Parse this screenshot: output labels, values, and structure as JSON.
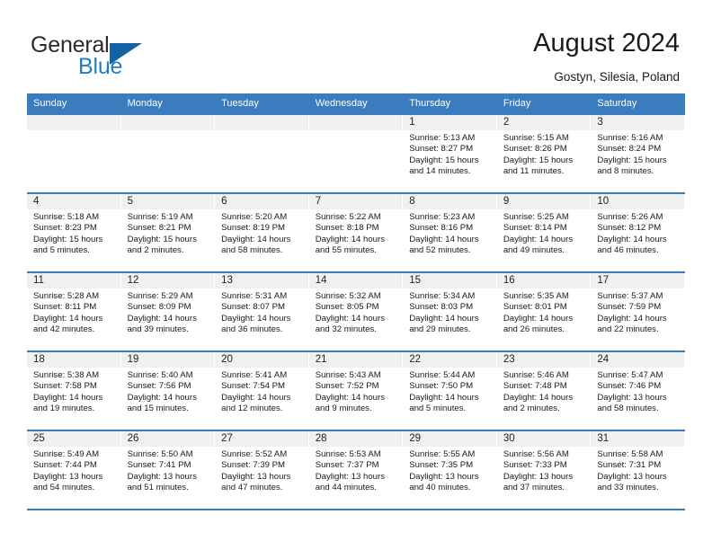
{
  "brand": {
    "name_top": "General",
    "name_bottom": "Blue",
    "triangle_color": "#1464a5",
    "blue_color": "#1f7fc4"
  },
  "header": {
    "title": "August 2024",
    "subtitle": "Gostyn, Silesia, Poland"
  },
  "theme": {
    "header_blue": "#3a7cbe",
    "day_band_gray": "#f0f0f0",
    "text_color": "#1a1a1a"
  },
  "weekdays": [
    "Sunday",
    "Monday",
    "Tuesday",
    "Wednesday",
    "Thursday",
    "Friday",
    "Saturday"
  ],
  "weeks": [
    [
      {
        "day": "",
        "sunrise": "",
        "sunset": "",
        "daylight_line1": "",
        "daylight_line2": ""
      },
      {
        "day": "",
        "sunrise": "",
        "sunset": "",
        "daylight_line1": "",
        "daylight_line2": ""
      },
      {
        "day": "",
        "sunrise": "",
        "sunset": "",
        "daylight_line1": "",
        "daylight_line2": ""
      },
      {
        "day": "",
        "sunrise": "",
        "sunset": "",
        "daylight_line1": "",
        "daylight_line2": ""
      },
      {
        "day": "1",
        "sunrise": "Sunrise: 5:13 AM",
        "sunset": "Sunset: 8:27 PM",
        "daylight_line1": "Daylight: 15 hours",
        "daylight_line2": "and 14 minutes."
      },
      {
        "day": "2",
        "sunrise": "Sunrise: 5:15 AM",
        "sunset": "Sunset: 8:26 PM",
        "daylight_line1": "Daylight: 15 hours",
        "daylight_line2": "and 11 minutes."
      },
      {
        "day": "3",
        "sunrise": "Sunrise: 5:16 AM",
        "sunset": "Sunset: 8:24 PM",
        "daylight_line1": "Daylight: 15 hours",
        "daylight_line2": "and 8 minutes."
      }
    ],
    [
      {
        "day": "4",
        "sunrise": "Sunrise: 5:18 AM",
        "sunset": "Sunset: 8:23 PM",
        "daylight_line1": "Daylight: 15 hours",
        "daylight_line2": "and 5 minutes."
      },
      {
        "day": "5",
        "sunrise": "Sunrise: 5:19 AM",
        "sunset": "Sunset: 8:21 PM",
        "daylight_line1": "Daylight: 15 hours",
        "daylight_line2": "and 2 minutes."
      },
      {
        "day": "6",
        "sunrise": "Sunrise: 5:20 AM",
        "sunset": "Sunset: 8:19 PM",
        "daylight_line1": "Daylight: 14 hours",
        "daylight_line2": "and 58 minutes."
      },
      {
        "day": "7",
        "sunrise": "Sunrise: 5:22 AM",
        "sunset": "Sunset: 8:18 PM",
        "daylight_line1": "Daylight: 14 hours",
        "daylight_line2": "and 55 minutes."
      },
      {
        "day": "8",
        "sunrise": "Sunrise: 5:23 AM",
        "sunset": "Sunset: 8:16 PM",
        "daylight_line1": "Daylight: 14 hours",
        "daylight_line2": "and 52 minutes."
      },
      {
        "day": "9",
        "sunrise": "Sunrise: 5:25 AM",
        "sunset": "Sunset: 8:14 PM",
        "daylight_line1": "Daylight: 14 hours",
        "daylight_line2": "and 49 minutes."
      },
      {
        "day": "10",
        "sunrise": "Sunrise: 5:26 AM",
        "sunset": "Sunset: 8:12 PM",
        "daylight_line1": "Daylight: 14 hours",
        "daylight_line2": "and 46 minutes."
      }
    ],
    [
      {
        "day": "11",
        "sunrise": "Sunrise: 5:28 AM",
        "sunset": "Sunset: 8:11 PM",
        "daylight_line1": "Daylight: 14 hours",
        "daylight_line2": "and 42 minutes."
      },
      {
        "day": "12",
        "sunrise": "Sunrise: 5:29 AM",
        "sunset": "Sunset: 8:09 PM",
        "daylight_line1": "Daylight: 14 hours",
        "daylight_line2": "and 39 minutes."
      },
      {
        "day": "13",
        "sunrise": "Sunrise: 5:31 AM",
        "sunset": "Sunset: 8:07 PM",
        "daylight_line1": "Daylight: 14 hours",
        "daylight_line2": "and 36 minutes."
      },
      {
        "day": "14",
        "sunrise": "Sunrise: 5:32 AM",
        "sunset": "Sunset: 8:05 PM",
        "daylight_line1": "Daylight: 14 hours",
        "daylight_line2": "and 32 minutes."
      },
      {
        "day": "15",
        "sunrise": "Sunrise: 5:34 AM",
        "sunset": "Sunset: 8:03 PM",
        "daylight_line1": "Daylight: 14 hours",
        "daylight_line2": "and 29 minutes."
      },
      {
        "day": "16",
        "sunrise": "Sunrise: 5:35 AM",
        "sunset": "Sunset: 8:01 PM",
        "daylight_line1": "Daylight: 14 hours",
        "daylight_line2": "and 26 minutes."
      },
      {
        "day": "17",
        "sunrise": "Sunrise: 5:37 AM",
        "sunset": "Sunset: 7:59 PM",
        "daylight_line1": "Daylight: 14 hours",
        "daylight_line2": "and 22 minutes."
      }
    ],
    [
      {
        "day": "18",
        "sunrise": "Sunrise: 5:38 AM",
        "sunset": "Sunset: 7:58 PM",
        "daylight_line1": "Daylight: 14 hours",
        "daylight_line2": "and 19 minutes."
      },
      {
        "day": "19",
        "sunrise": "Sunrise: 5:40 AM",
        "sunset": "Sunset: 7:56 PM",
        "daylight_line1": "Daylight: 14 hours",
        "daylight_line2": "and 15 minutes."
      },
      {
        "day": "20",
        "sunrise": "Sunrise: 5:41 AM",
        "sunset": "Sunset: 7:54 PM",
        "daylight_line1": "Daylight: 14 hours",
        "daylight_line2": "and 12 minutes."
      },
      {
        "day": "21",
        "sunrise": "Sunrise: 5:43 AM",
        "sunset": "Sunset: 7:52 PM",
        "daylight_line1": "Daylight: 14 hours",
        "daylight_line2": "and 9 minutes."
      },
      {
        "day": "22",
        "sunrise": "Sunrise: 5:44 AM",
        "sunset": "Sunset: 7:50 PM",
        "daylight_line1": "Daylight: 14 hours",
        "daylight_line2": "and 5 minutes."
      },
      {
        "day": "23",
        "sunrise": "Sunrise: 5:46 AM",
        "sunset": "Sunset: 7:48 PM",
        "daylight_line1": "Daylight: 14 hours",
        "daylight_line2": "and 2 minutes."
      },
      {
        "day": "24",
        "sunrise": "Sunrise: 5:47 AM",
        "sunset": "Sunset: 7:46 PM",
        "daylight_line1": "Daylight: 13 hours",
        "daylight_line2": "and 58 minutes."
      }
    ],
    [
      {
        "day": "25",
        "sunrise": "Sunrise: 5:49 AM",
        "sunset": "Sunset: 7:44 PM",
        "daylight_line1": "Daylight: 13 hours",
        "daylight_line2": "and 54 minutes."
      },
      {
        "day": "26",
        "sunrise": "Sunrise: 5:50 AM",
        "sunset": "Sunset: 7:41 PM",
        "daylight_line1": "Daylight: 13 hours",
        "daylight_line2": "and 51 minutes."
      },
      {
        "day": "27",
        "sunrise": "Sunrise: 5:52 AM",
        "sunset": "Sunset: 7:39 PM",
        "daylight_line1": "Daylight: 13 hours",
        "daylight_line2": "and 47 minutes."
      },
      {
        "day": "28",
        "sunrise": "Sunrise: 5:53 AM",
        "sunset": "Sunset: 7:37 PM",
        "daylight_line1": "Daylight: 13 hours",
        "daylight_line2": "and 44 minutes."
      },
      {
        "day": "29",
        "sunrise": "Sunrise: 5:55 AM",
        "sunset": "Sunset: 7:35 PM",
        "daylight_line1": "Daylight: 13 hours",
        "daylight_line2": "and 40 minutes."
      },
      {
        "day": "30",
        "sunrise": "Sunrise: 5:56 AM",
        "sunset": "Sunset: 7:33 PM",
        "daylight_line1": "Daylight: 13 hours",
        "daylight_line2": "and 37 minutes."
      },
      {
        "day": "31",
        "sunrise": "Sunrise: 5:58 AM",
        "sunset": "Sunset: 7:31 PM",
        "daylight_line1": "Daylight: 13 hours",
        "daylight_line2": "and 33 minutes."
      }
    ]
  ]
}
